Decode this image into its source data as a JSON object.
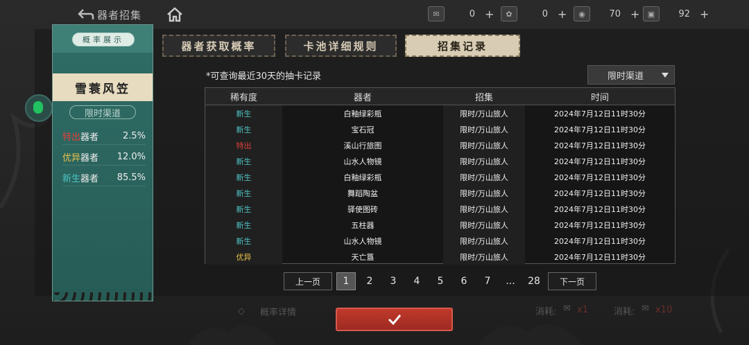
{
  "topbar": {
    "back_label": "器者招集",
    "resources": [
      {
        "icon": "ticket-icon",
        "value": "0"
      },
      {
        "icon": "coin-icon",
        "value": "0"
      },
      {
        "icon": "token-icon",
        "value": "70"
      },
      {
        "icon": "scroll-icon",
        "value": "92"
      }
    ],
    "plus": "+"
  },
  "card": {
    "tag": "概率展示",
    "name": "雪蓑风笠",
    "channel": "限时渠道",
    "rates": [
      {
        "tier": "特出",
        "suffix": "器者",
        "pct": "2.5%",
        "color": "#e0403a"
      },
      {
        "tier": "优异",
        "suffix": "器者",
        "pct": "12.0%",
        "color": "#e8c14a"
      },
      {
        "tier": "新生",
        "suffix": "器者",
        "pct": "85.5%",
        "color": "#4fc3c5"
      }
    ]
  },
  "tabs": [
    {
      "label": "器者获取概率",
      "active": false
    },
    {
      "label": "卡池详细规则",
      "active": false
    },
    {
      "label": "招集记录",
      "active": true
    }
  ],
  "records": {
    "note": "*可查询最近30天的抽卡记录",
    "filter": "限时渠道",
    "headers": [
      "稀有度",
      "器者",
      "招集",
      "时间"
    ],
    "rows": [
      {
        "rarity": "新生",
        "item": "白釉绿彩瓶",
        "pool": "限时/万山旅人",
        "time": "2024年7月12日11时30分"
      },
      {
        "rarity": "新生",
        "item": "宝石冠",
        "pool": "限时/万山旅人",
        "time": "2024年7月12日11时30分"
      },
      {
        "rarity": "特出",
        "item": "溪山行旅图",
        "pool": "限时/万山旅人",
        "time": "2024年7月12日11时30分"
      },
      {
        "rarity": "新生",
        "item": "山水人物镜",
        "pool": "限时/万山旅人",
        "time": "2024年7月12日11时30分"
      },
      {
        "rarity": "新生",
        "item": "白釉绿彩瓶",
        "pool": "限时/万山旅人",
        "time": "2024年7月12日11时30分"
      },
      {
        "rarity": "新生",
        "item": "舞蹈陶盆",
        "pool": "限时/万山旅人",
        "time": "2024年7月12日11时30分"
      },
      {
        "rarity": "新生",
        "item": "驿使图砖",
        "pool": "限时/万山旅人",
        "time": "2024年7月12日11时30分"
      },
      {
        "rarity": "新生",
        "item": "五柱器",
        "pool": "限时/万山旅人",
        "time": "2024年7月12日11时30分"
      },
      {
        "rarity": "新生",
        "item": "山水人物镜",
        "pool": "限时/万山旅人",
        "time": "2024年7月12日11时30分"
      },
      {
        "rarity": "优异",
        "item": "天亡簋",
        "pool": "限时/万山旅人",
        "time": "2024年7月12日11时30分"
      }
    ],
    "rarity_colors": {
      "新生": "#4fc3c5",
      "特出": "#e0403a",
      "优异": "#e8c14a"
    }
  },
  "pager": {
    "prev": "上一页",
    "next": "下一页",
    "pages": [
      "1",
      "2",
      "3",
      "4",
      "5",
      "6",
      "7",
      "...",
      "28"
    ],
    "current": "1"
  },
  "bottom": {
    "detail_label": "概率详情",
    "cost_label_1": "消耗:",
    "cost_count_1": "x1",
    "cost_label_2": "消耗:",
    "cost_count_2": "x10"
  },
  "colors": {
    "accent_red": "#c0392b",
    "card_teal": "#2f6d66",
    "tab_active": "#d8cdb4"
  }
}
